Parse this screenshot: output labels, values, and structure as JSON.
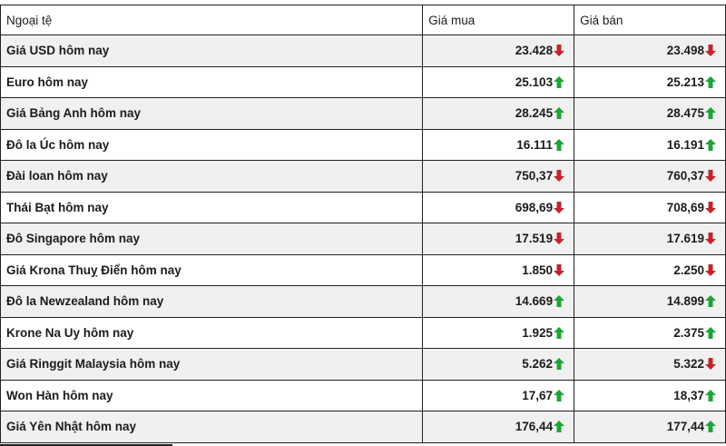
{
  "header": {
    "currency": "Ngoại tệ",
    "buy": "Giá mua",
    "sell": "Giá bán"
  },
  "colors": {
    "up": "#1ea33a",
    "down": "#c0262d",
    "alt_row": "#f0f0f0"
  },
  "rows": [
    {
      "name": "Giá USD hôm nay",
      "buy": "23.428",
      "buy_dir": "down",
      "sell": "23.498",
      "sell_dir": "down"
    },
    {
      "name": "Euro hôm nay",
      "buy": "25.103",
      "buy_dir": "up",
      "sell": "25.213",
      "sell_dir": "up"
    },
    {
      "name": "Giá Bảng Anh hôm nay",
      "buy": "28.245",
      "buy_dir": "up",
      "sell": "28.475",
      "sell_dir": "up"
    },
    {
      "name": "Đô la Úc hôm nay",
      "buy": "16.111",
      "buy_dir": "up",
      "sell": "16.191",
      "sell_dir": "up"
    },
    {
      "name": "Đài loan hôm nay",
      "buy": "750,37",
      "buy_dir": "down",
      "sell": "760,37",
      "sell_dir": "down"
    },
    {
      "name": "Thái Bạt hôm nay",
      "buy": "698,69",
      "buy_dir": "down",
      "sell": "708,69",
      "sell_dir": "down"
    },
    {
      "name": "Đô Singapore hôm nay",
      "buy": "17.519",
      "buy_dir": "down",
      "sell": "17.619",
      "sell_dir": "down"
    },
    {
      "name": "Giá Krona Thuỵ Điển hôm nay",
      "buy": "1.850",
      "buy_dir": "down",
      "sell": "2.250",
      "sell_dir": "down"
    },
    {
      "name": "Đô la Newzealand hôm nay",
      "buy": "14.669",
      "buy_dir": "up",
      "sell": "14.899",
      "sell_dir": "up"
    },
    {
      "name": "Krone Na Uy hôm nay",
      "buy": "1.925",
      "buy_dir": "up",
      "sell": "2.375",
      "sell_dir": "up"
    },
    {
      "name": "Giá Ringgit Malaysia hôm nay",
      "buy": "5.262",
      "buy_dir": "up",
      "sell": "5.322",
      "sell_dir": "down"
    },
    {
      "name": "Won Hàn hôm nay",
      "buy": "17,67",
      "buy_dir": "up",
      "sell": "18,37",
      "sell_dir": "up"
    },
    {
      "name": "Giá Yên Nhật hôm nay",
      "buy": "176,44",
      "buy_dir": "up",
      "sell": "177,44",
      "sell_dir": "up"
    }
  ]
}
